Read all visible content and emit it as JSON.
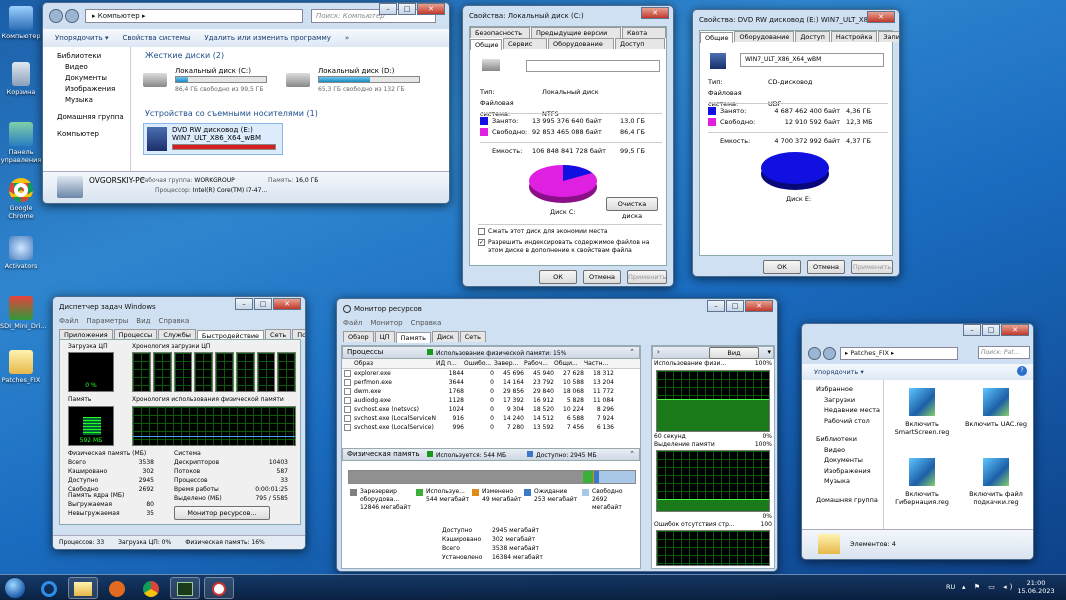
{
  "desktop": {
    "icons": [
      "Компьютер",
      "Корзина",
      "Панель управления",
      "Google Chrome",
      "Activators",
      "SDI_Mini_Dri...",
      "Patches_FIX"
    ]
  },
  "explorer": {
    "path": "Компьютер",
    "search": "Поиск: Компьютер",
    "toolbar": [
      "Упорядочить ▾",
      "Свойства системы",
      "Удалить или изменить программу",
      "»"
    ],
    "nav": [
      "Библиотеки",
      "Видео",
      "Документы",
      "Изображения",
      "Музыка",
      "Домашняя группа",
      "Компьютер"
    ],
    "hdd_header": "Жесткие диски (2)",
    "drive_c": {
      "name": "Локальный диск (C:)",
      "free": "86,4 ГБ свободно из 99,5 ГБ",
      "fill": 0.13
    },
    "drive_d": {
      "name": "Локальный диск (D:)",
      "free": "65,3 ГБ свободно из 132 ГБ",
      "fill": 0.51
    },
    "removable_header": "Устройства со съемными носителями (1)",
    "dvd": {
      "name": "DVD RW дисковод (E:)",
      "label": "WIN7_ULT_X86_X64_wBM"
    },
    "pc": {
      "name": "OVGORSKIY-PC",
      "wg_label": "Рабочая группа:",
      "wg": "WORKGROUP",
      "mem_label": "Память:",
      "mem": "16,0 ГБ",
      "cpu_label": "Процессор:",
      "cpu": "Intel(R) Core(TM) i7-47..."
    }
  },
  "propc": {
    "title": "Свойства: Локальный диск (C:)",
    "tabs1": [
      "Безопасность",
      "Предыдущие версии",
      "Квота"
    ],
    "tabs2": [
      "Общие",
      "Сервис",
      "Оборудование",
      "Доступ"
    ],
    "type_l": "Тип:",
    "type": "Локальный диск",
    "fs_l": "Файловая система:",
    "fs": "NTFS",
    "used_l": "Занято:",
    "used_b": "13 995 376 640 байт",
    "used_g": "13,0 ГБ",
    "free_l": "Свободно:",
    "free_b": "92 853 465 088 байт",
    "free_g": "86,4 ГБ",
    "cap_l": "Емкость:",
    "cap_b": "106 848 841 728 байт",
    "cap_g": "99,5 ГБ",
    "disk": "Диск C:",
    "cleanup": "Очистка диска",
    "chk1": "Сжать этот диск для экономии места",
    "chk2": "Разрешить индексировать содержимое файлов на этом диске в дополнение к свойствам файла",
    "ok": "ОК",
    "cancel": "Отмена",
    "apply": "Применить"
  },
  "prope": {
    "title": "Свойства: DVD RW дисковод (E:) WIN7_ULT_X86...",
    "tabs": [
      "Общие",
      "Оборудование",
      "Доступ",
      "Настройка",
      "Запись"
    ],
    "label": "WIN7_ULT_X86_X64_wBM",
    "type_l": "Тип:",
    "type": "CD-дисковод",
    "fs_l": "Файловая система:",
    "fs": "UDF",
    "used_l": "Занято:",
    "used_b": "4 687 462 400 байт",
    "used_g": "4,36 ГБ",
    "free_l": "Свободно:",
    "free_b": "12 910 592 байт",
    "free_g": "12,3 МБ",
    "cap_l": "Емкость:",
    "cap_b": "4 700 372 992 байт",
    "cap_g": "4,37 ГБ",
    "disk": "Диск E:",
    "ok": "ОК",
    "cancel": "Отмена",
    "apply": "Применить"
  },
  "taskmgr": {
    "title": "Диспетчер задач Windows",
    "menu": [
      "Файл",
      "Параметры",
      "Вид",
      "Справка"
    ],
    "tabs": [
      "Приложения",
      "Процессы",
      "Службы",
      "Быстродействие",
      "Сеть",
      "Пользователи"
    ],
    "cpu_l": "Загрузка ЦП",
    "cpu_v": "0 %",
    "cpu_hist": "Хронология загрузки ЦП",
    "mem_l": "Память",
    "mem_v": "592 МБ",
    "mem_hist": "Хронология использования физической памяти",
    "phys_h": "Физическая память (МБ)",
    "phys": [
      [
        "Всего",
        "3538"
      ],
      [
        "Кэшировано",
        "302"
      ],
      [
        "Доступно",
        "2945"
      ],
      [
        "Свободно",
        "2692"
      ]
    ],
    "sys_h": "Система",
    "sys": [
      [
        "Дескрипторов",
        "10403"
      ],
      [
        "Потоков",
        "587"
      ],
      [
        "Процессов",
        "33"
      ],
      [
        "Время работы",
        "0:00:01:25"
      ],
      [
        "Выделено (МБ)",
        "795 / 5585"
      ]
    ],
    "kern_h": "Память ядра (МБ)",
    "kern": [
      [
        "Выгружаемая",
        "80"
      ],
      [
        "Невыгружаемая",
        "35"
      ]
    ],
    "resmon_btn": "Монитор ресурсов...",
    "status": [
      "Процессов: 33",
      "Загрузка ЦП: 0%",
      "Физическая память: 16%"
    ]
  },
  "resmon": {
    "title": "Монитор ресурсов",
    "menu": [
      "Файл",
      "Монитор",
      "Справка"
    ],
    "tabs": [
      "Обзор",
      "ЦП",
      "Память",
      "Диск",
      "Сеть"
    ],
    "proc_h": "Процессы",
    "proc_use": "Использование физической памяти: 15%",
    "cols": [
      "Образ",
      "ИД п...",
      "Ошибо...",
      "Завер...",
      "Рабоч...",
      "Общи...",
      "Частн..."
    ],
    "rows": [
      [
        "explorer.exe",
        "1844",
        "0",
        "45 696",
        "45 940",
        "27 628",
        "18 312"
      ],
      [
        "perfmon.exe",
        "3644",
        "0",
        "14 164",
        "23 792",
        "10 588",
        "13 204"
      ],
      [
        "dwm.exe",
        "1768",
        "0",
        "29 856",
        "29 840",
        "18 068",
        "11 772"
      ],
      [
        "audiodg.exe",
        "1128",
        "0",
        "17 392",
        "16 912",
        "5 828",
        "11 084"
      ],
      [
        "svchost.exe (netsvcs)",
        "1024",
        "0",
        "9 304",
        "18 520",
        "10 224",
        "8 296"
      ],
      [
        "svchost.exe (LocalServiceNet...",
        "916",
        "0",
        "14 240",
        "14 512",
        "6 588",
        "7 924"
      ],
      [
        "svchost.exe (LocalService)",
        "996",
        "0",
        "7 280",
        "13 592",
        "7 456",
        "6 136"
      ]
    ],
    "phys_h": "Физическая память",
    "phys_used": "Используется: 544 МБ",
    "phys_avail": "Доступно: 2945 МБ",
    "legend": [
      [
        "Зарезервир оборудова...",
        "12846 мегабайт",
        "#808080"
      ],
      [
        "Используе...",
        "544 мегабайт",
        "#3cae3c"
      ],
      [
        "Изменено",
        "49 мегабайт",
        "#e08b1a"
      ],
      [
        "Ожидание",
        "253 мегабайт",
        "#3a78c8"
      ],
      [
        "Свободно",
        "2692 мегабайт",
        "#a9c8e8"
      ]
    ],
    "stats": [
      [
        "Доступно",
        "2945 мегабайт"
      ],
      [
        "Кэшировано",
        "302 мегабайт"
      ],
      [
        "Всего",
        "3538 мегабайт"
      ],
      [
        "Установлено",
        "16384 мегабайт"
      ]
    ],
    "view": "Вид",
    "g1": "Использование физи...",
    "g1v": "100%",
    "g1t": "60 секунд",
    "g1z": "0%",
    "g2": "Выделение памяти",
    "g2v": "100%",
    "g2z": "0%",
    "g3": "Ошибок отсутствия стр...",
    "g3v": "100"
  },
  "patches": {
    "path": "Patches_FIX",
    "search": "Поиск: Pat...",
    "toolbar": "Упорядочить ▾",
    "nav": [
      "Избранное",
      "Загрузки",
      "Недавние места",
      "Рабочий стол",
      "Библиотеки",
      "Видео",
      "Документы",
      "Изображения",
      "Музыка",
      "Домашняя группа"
    ],
    "files": [
      "Включить SmartScreen.reg",
      "Включить UAC.reg",
      "Включить Гибернация.reg",
      "Включить файл подкачки.reg"
    ],
    "status": "Элементов: 4"
  },
  "tray": {
    "lang": "RU",
    "time": "21:00",
    "date": "15.06.2023"
  }
}
